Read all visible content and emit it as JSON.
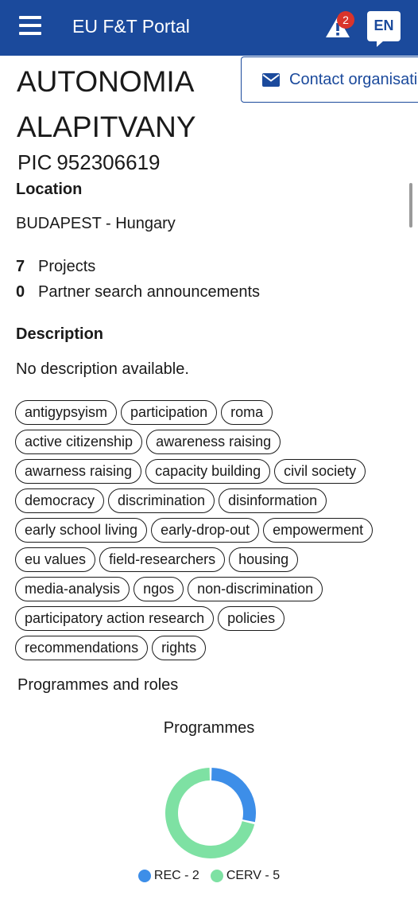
{
  "header": {
    "title": "EU F&T Portal",
    "notification_count": "2",
    "language": "EN"
  },
  "contact_button": {
    "label": "Contact organisation",
    "icon": "envelope-icon"
  },
  "organisation": {
    "name": "AUTONOMIA ALAPITVANY",
    "pic_label": "PIC",
    "pic": "952306619"
  },
  "location": {
    "heading": "Location",
    "value": "BUDAPEST - Hungary"
  },
  "stats": [
    {
      "count": "7",
      "label": "Projects"
    },
    {
      "count": "0",
      "label": "Partner search announcements"
    }
  ],
  "description": {
    "heading": "Description",
    "text": "No description available."
  },
  "keywords": [
    "antigypsyism",
    "participation",
    "roma",
    "active citizenship",
    "awareness raising",
    "awarness raising",
    "capacity building",
    "civil society",
    "democracy",
    "discrimination",
    "disinformation",
    "early school living",
    "early-drop-out",
    "empowerment",
    "eu values",
    "field-researchers",
    "housing",
    "media-analysis",
    "ngos",
    "non-discrimination",
    "participatory action research",
    "policies",
    "recommendations",
    "rights"
  ],
  "programmes_roles": {
    "heading": "Programmes and roles"
  },
  "colors": {
    "header": "#1b4a9c",
    "rec": "#3d8ee8",
    "cerv": "#7ee1a3",
    "badge": "#d9342b"
  },
  "chart_data": {
    "type": "pie",
    "title": "Programmes",
    "donut": true,
    "categories": [
      "REC",
      "CERV"
    ],
    "values": [
      2,
      5
    ],
    "legend": [
      "REC - 2",
      "CERV - 5"
    ],
    "legend_position": "bottom",
    "colors": [
      "#3d8ee8",
      "#7ee1a3"
    ]
  }
}
